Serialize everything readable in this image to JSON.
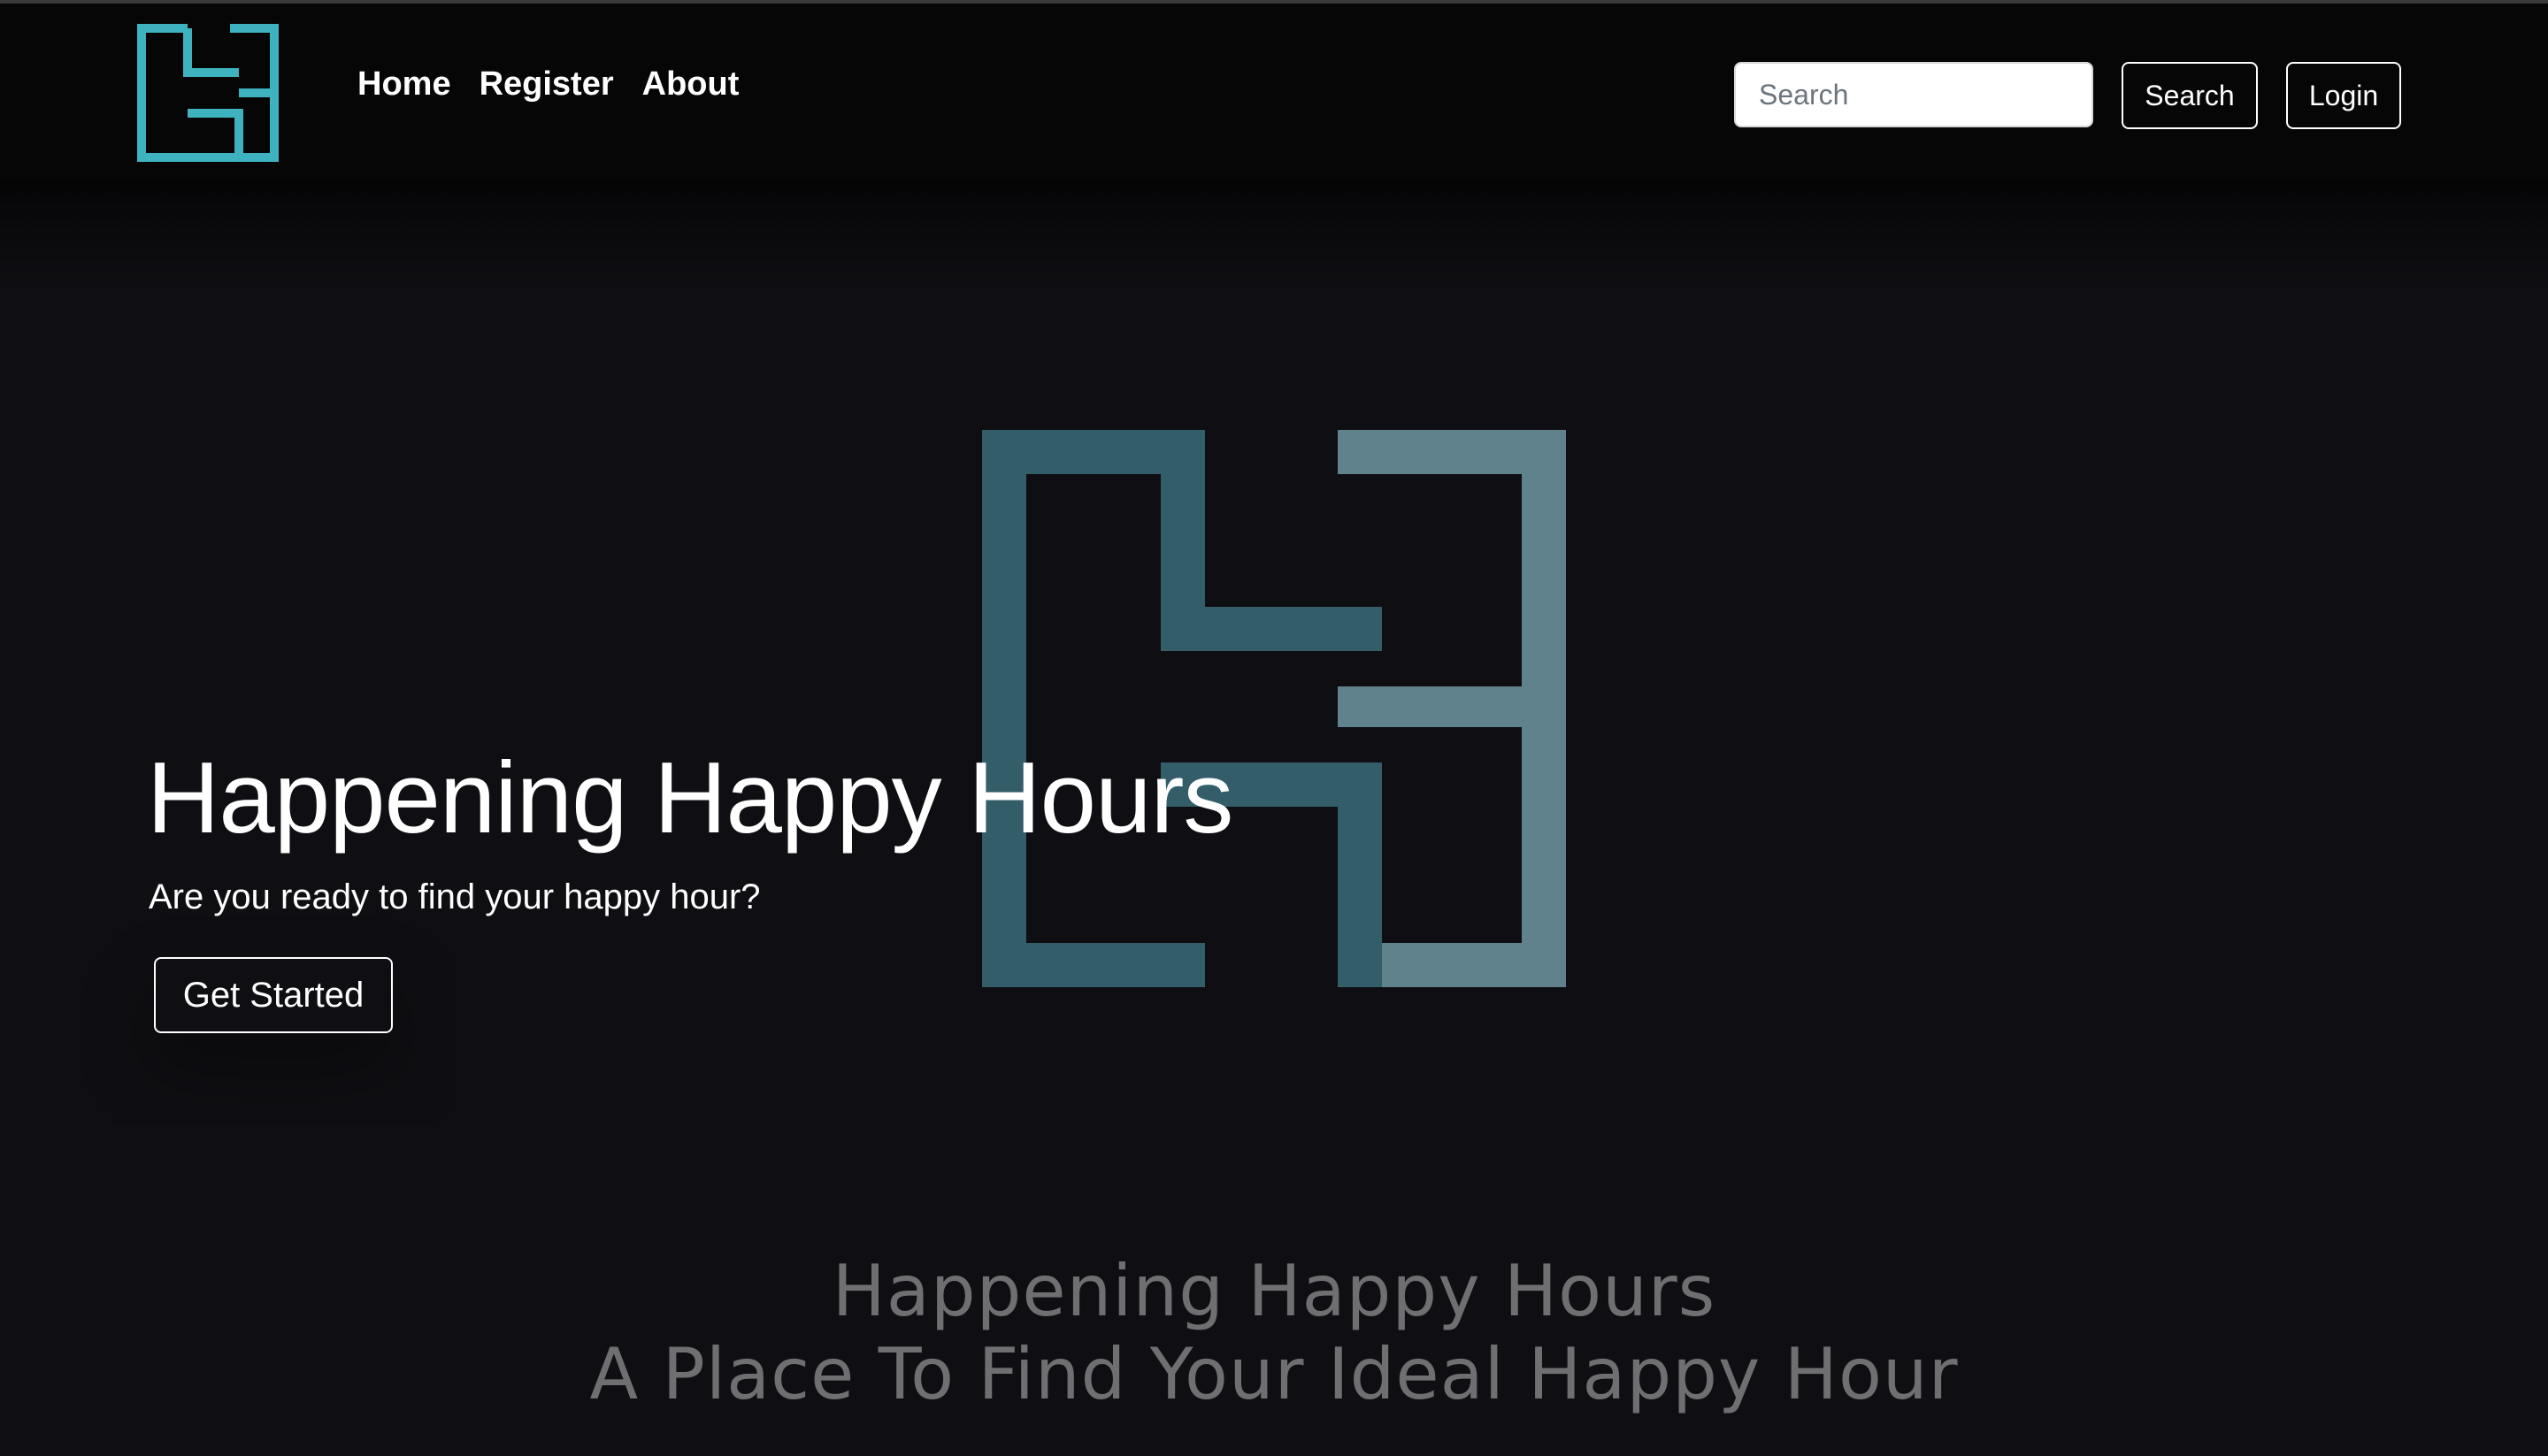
{
  "nav": {
    "logo_alt": "Happening Happy Hours logo",
    "links": [
      {
        "label": "Home"
      },
      {
        "label": "Register"
      },
      {
        "label": "About"
      }
    ],
    "search": {
      "placeholder": "Search",
      "value": "",
      "button_label": "Search"
    },
    "login_label": "Login"
  },
  "hero": {
    "title": "Happening Happy Hours",
    "subtitle": "Are you ready to find your happy hour?",
    "cta_label": "Get Started",
    "brand_line1": "Happening Happy Hours",
    "brand_line2": "A Place To Find Your Ideal Happy Hour"
  },
  "colors": {
    "accent_teal": "#3fb2c0",
    "logo_teal_dark": "#335d69",
    "logo_teal_light": "#5f828d",
    "background": "#0f0e12",
    "navbar": "#060607"
  }
}
